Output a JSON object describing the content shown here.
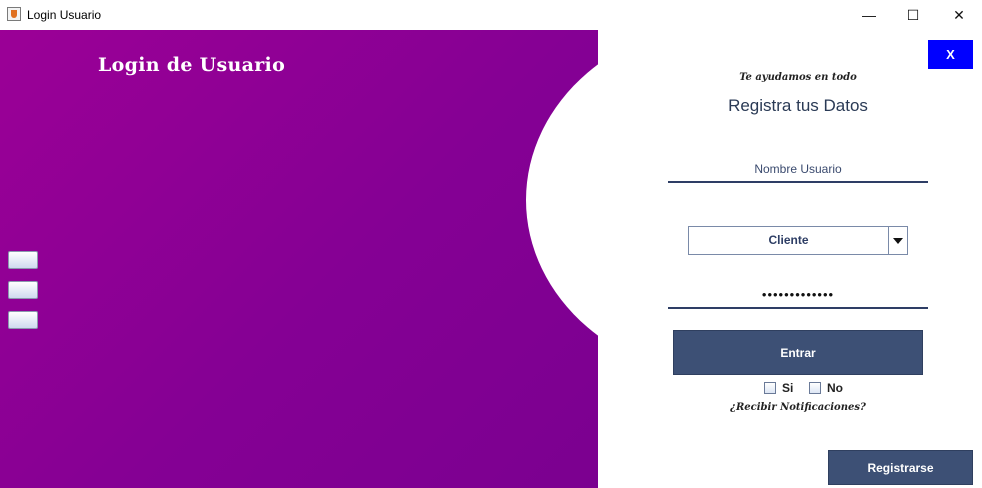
{
  "window": {
    "title": "Login Usuario",
    "icon": "java-cup-icon",
    "controls": {
      "minimize": "—",
      "maximize": "☐",
      "close": "✕"
    }
  },
  "left_panel": {
    "title": "Login de Usuario",
    "gradient_colors": [
      "#9b0096",
      "#7b0090"
    ],
    "side_buttons": [
      "",
      "",
      ""
    ]
  },
  "form": {
    "close_label": "X",
    "tagline": "Te ayudamos en todo",
    "heading": "Registra tus Datos",
    "username_value": "Nombre Usuario",
    "role_select_value": "Cliente",
    "password_value": "•••••••••••••",
    "enter_label": "Entrar",
    "option_yes": "Si",
    "option_no": "No",
    "notifications_question": "¿Recibir Notificaciones?",
    "register_label": "Registrarse"
  },
  "colors": {
    "accent_blue": "#0000ff",
    "button_navy": "#3d5075"
  }
}
